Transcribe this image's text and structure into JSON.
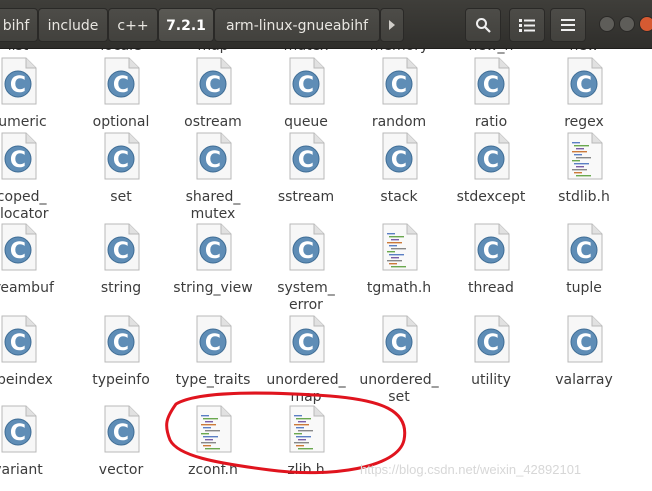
{
  "breadcrumbs": [
    "bihf",
    "include",
    "c++",
    "7.2.1",
    "arm-linux-gnueabihf"
  ],
  "header_icons": [
    "search-icon",
    "view-list-icon",
    "menu-icon"
  ],
  "partial_top_labels": [
    "list",
    "locale",
    "map",
    "mutex",
    "memory",
    "new_h",
    "new"
  ],
  "rows": [
    [
      {
        "label": "numeric",
        "type": "c"
      },
      {
        "label": "optional",
        "type": "c"
      },
      {
        "label": "ostream",
        "type": "c"
      },
      {
        "label": "queue",
        "type": "c"
      },
      {
        "label": "random",
        "type": "c"
      },
      {
        "label": "ratio",
        "type": "c"
      },
      {
        "label": "regex",
        "type": "c"
      }
    ],
    [
      {
        "label": "scoped_",
        "label2": "allocator",
        "type": "c"
      },
      {
        "label": "set",
        "type": "c"
      },
      {
        "label": "shared_",
        "label2": "mutex",
        "type": "c"
      },
      {
        "label": "sstream",
        "type": "c"
      },
      {
        "label": "stack",
        "type": "c"
      },
      {
        "label": "stdexcept",
        "type": "c"
      },
      {
        "label": "stdlib.h",
        "type": "h"
      }
    ],
    [
      {
        "label": "streambuf",
        "type": "c"
      },
      {
        "label": "string",
        "type": "c"
      },
      {
        "label": "string_view",
        "type": "c"
      },
      {
        "label": "system_",
        "label2": "error",
        "type": "c"
      },
      {
        "label": "tgmath.h",
        "type": "h"
      },
      {
        "label": "thread",
        "type": "c"
      },
      {
        "label": "tuple",
        "type": "c"
      }
    ],
    [
      {
        "label": "typeindex",
        "type": "c"
      },
      {
        "label": "typeinfo",
        "type": "c"
      },
      {
        "label": "type_traits",
        "type": "c"
      },
      {
        "label": "unordered_",
        "label2": "map",
        "type": "c"
      },
      {
        "label": "unordered_",
        "label2": "set",
        "type": "c"
      },
      {
        "label": "utility",
        "type": "c"
      },
      {
        "label": "valarray",
        "type": "c"
      }
    ],
    [
      {
        "label": "variant",
        "type": "c"
      },
      {
        "label": "vector",
        "type": "c"
      },
      {
        "label": "zconf.h",
        "type": "h"
      },
      {
        "label": "zlib.h",
        "type": "h"
      }
    ]
  ],
  "watermark": "https://blog.csdn.net/weixin_42892101",
  "colors": {
    "annotation": "#e0141e",
    "header_bg": "#3c3b37",
    "c_icon": "#5f8db6",
    "label": "#3c3c3c"
  }
}
